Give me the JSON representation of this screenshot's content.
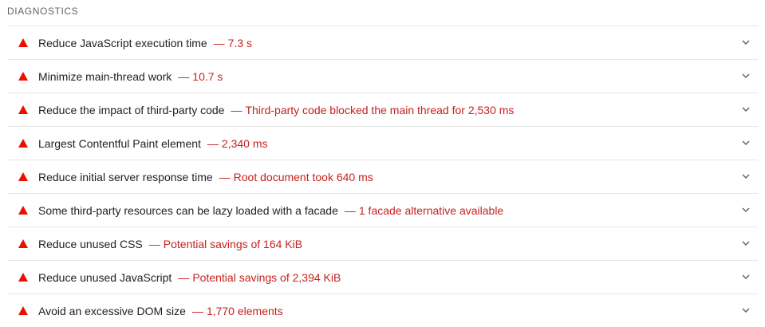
{
  "section": {
    "title": "DIAGNOSTICS"
  },
  "colors": {
    "warning": "#eb0f00",
    "value_text": "#c5221f",
    "title_text": "#202124",
    "header_text": "#5f6368",
    "divider": "#e6e6e6"
  },
  "audits": [
    {
      "title": "Reduce JavaScript execution time",
      "separator": "—",
      "value": "7.3 s",
      "status_icon": "warning-triangle-icon",
      "expand_icon": "chevron-down-icon"
    },
    {
      "title": "Minimize main-thread work",
      "separator": "—",
      "value": "10.7 s",
      "status_icon": "warning-triangle-icon",
      "expand_icon": "chevron-down-icon"
    },
    {
      "title": "Reduce the impact of third-party code",
      "separator": "—",
      "value": "Third-party code blocked the main thread for 2,530 ms",
      "status_icon": "warning-triangle-icon",
      "expand_icon": "chevron-down-icon"
    },
    {
      "title": "Largest Contentful Paint element",
      "separator": "—",
      "value": "2,340 ms",
      "status_icon": "warning-triangle-icon",
      "expand_icon": "chevron-down-icon"
    },
    {
      "title": "Reduce initial server response time",
      "separator": "—",
      "value": "Root document took 640 ms",
      "status_icon": "warning-triangle-icon",
      "expand_icon": "chevron-down-icon"
    },
    {
      "title": "Some third-party resources can be lazy loaded with a facade",
      "separator": "—",
      "value": "1 facade alternative available",
      "status_icon": "warning-triangle-icon",
      "expand_icon": "chevron-down-icon"
    },
    {
      "title": "Reduce unused CSS",
      "separator": "—",
      "value": "Potential savings of 164 KiB",
      "status_icon": "warning-triangle-icon",
      "expand_icon": "chevron-down-icon"
    },
    {
      "title": "Reduce unused JavaScript",
      "separator": "—",
      "value": "Potential savings of 2,394 KiB",
      "status_icon": "warning-triangle-icon",
      "expand_icon": "chevron-down-icon"
    },
    {
      "title": "Avoid an excessive DOM size",
      "separator": "—",
      "value": "1,770 elements",
      "status_icon": "warning-triangle-icon",
      "expand_icon": "chevron-down-icon"
    }
  ]
}
